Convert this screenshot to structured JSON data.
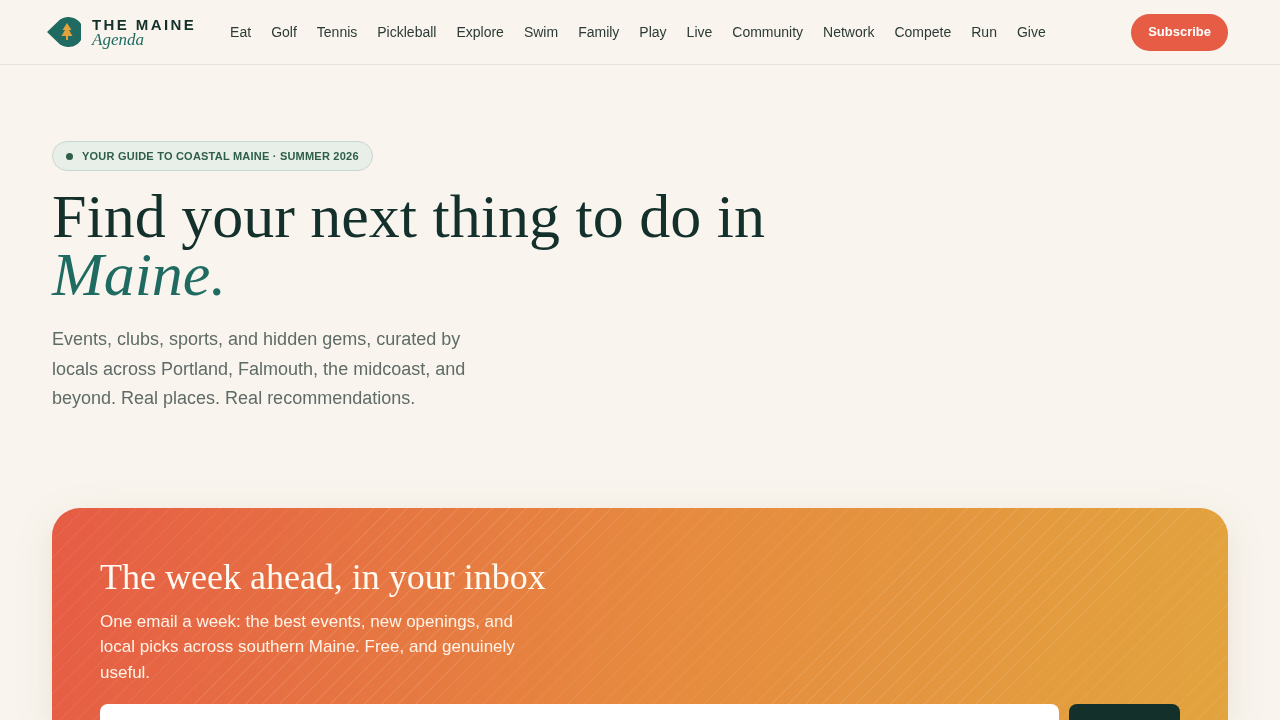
{
  "header": {
    "logo": {
      "line_1": "THE MAINE",
      "line_2": "Agenda"
    },
    "nav": [
      "Eat",
      "Golf",
      "Tennis",
      "Pickleball",
      "Explore",
      "Swim",
      "Family",
      "Play",
      "Live",
      "Community",
      "Network",
      "Compete",
      "Run",
      "Give"
    ],
    "subscribe_button": "Subscribe"
  },
  "hero": {
    "badge": "YOUR GUIDE TO COASTAL MAINE · SUMMER 2026",
    "headline": "Find your next thing to do in",
    "headline_emphasis": "Maine.",
    "intro": "Events, clubs, sports, and hidden gems, curated by locals across Portland, Falmouth, the midcoast, and beyond. Real places. Real recommendations."
  },
  "newsletter": {
    "title": "The week ahead, in your inbox",
    "text": "One email a week: the best events, new openings, and local picks across southern Maine. Free, and genuinely useful."
  }
}
